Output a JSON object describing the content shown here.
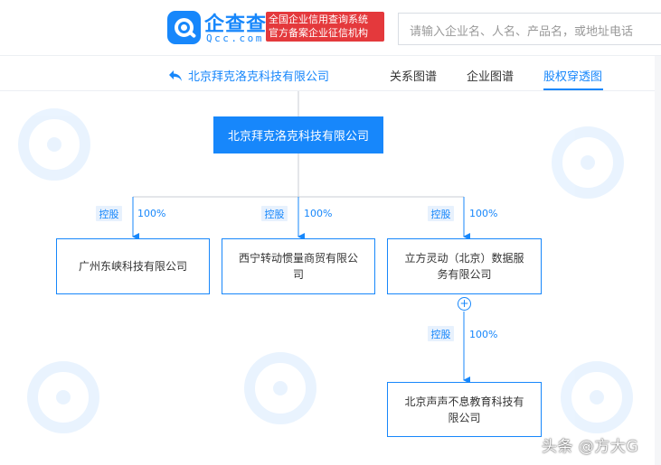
{
  "header": {
    "logo_title": "企查查",
    "logo_domain": "Qcc.com",
    "badge_line1": "全国企业信用查询系统",
    "badge_line2": "官方备案企业征信机构",
    "search_placeholder": "请输入企业名、人名、产品名，或地址电话"
  },
  "subnav": {
    "back_label": "北京拜克洛克科技有限公司",
    "tabs": [
      {
        "label": "关系图谱",
        "active": false
      },
      {
        "label": "企业图谱",
        "active": false
      },
      {
        "label": "股权穿透图",
        "active": true
      }
    ]
  },
  "chart": {
    "root": "北京拜克洛克科技有限公司",
    "children": [
      {
        "name": "广州东峡科技有限公司",
        "relation": "控股",
        "percent": "100%"
      },
      {
        "name": "西宁转动惯量商贸有限公司",
        "relation": "控股",
        "percent": "100%"
      },
      {
        "name": "立方灵动（北京）数据服务有限公司",
        "relation": "控股",
        "percent": "100%"
      }
    ],
    "grandchild": {
      "name": "北京声声不息教育科技有限公司",
      "relation": "控股",
      "percent": "100%"
    },
    "expand_symbol": "+"
  },
  "watermark_text": "头条 @方大G",
  "colors": {
    "accent": "#1787fb",
    "badge": "#e4393c",
    "tag_bg": "#e7f1fd"
  }
}
